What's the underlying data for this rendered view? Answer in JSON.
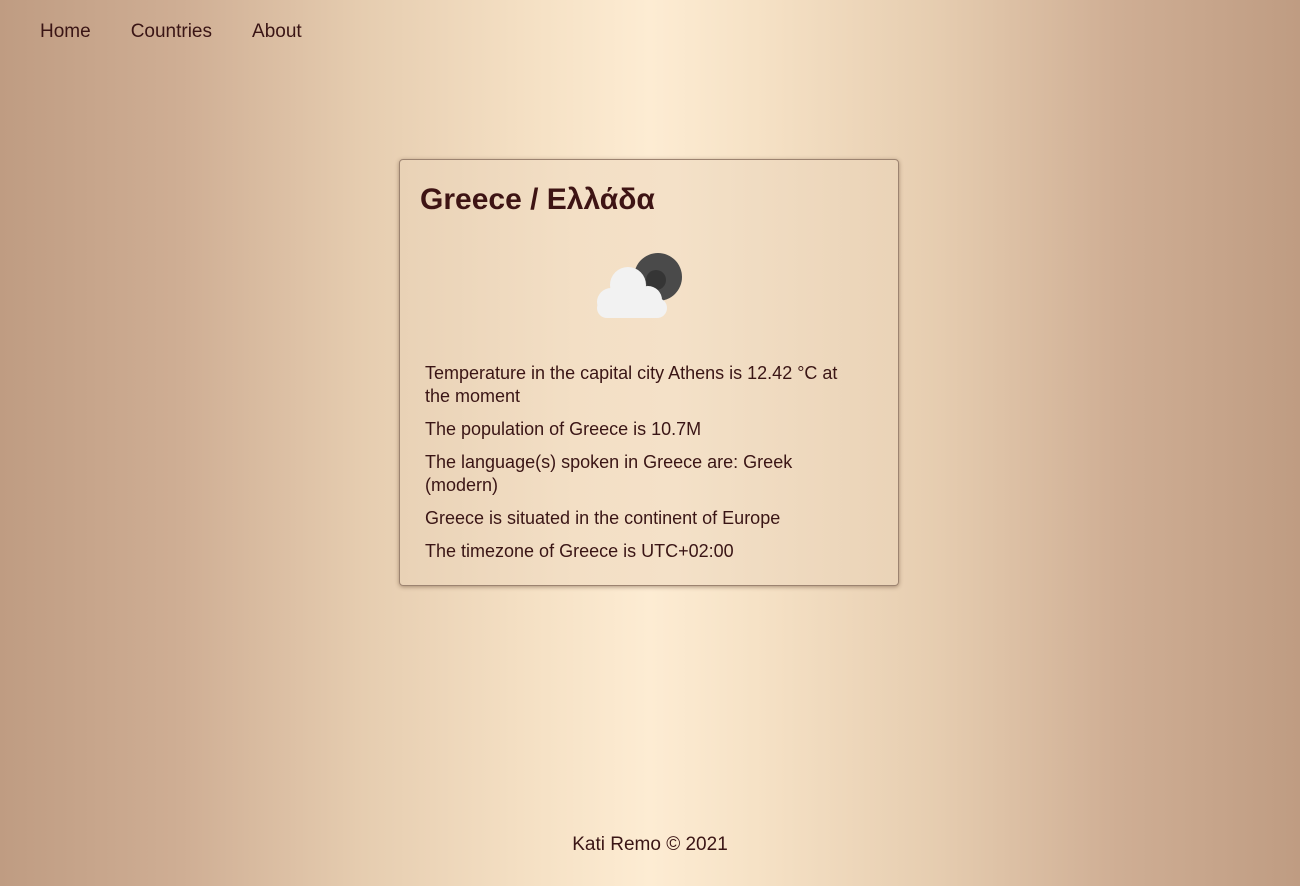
{
  "nav": {
    "items": [
      {
        "label": "Home"
      },
      {
        "label": "Countries"
      },
      {
        "label": "About"
      }
    ]
  },
  "card": {
    "title": "Greece / Ελλάδα",
    "weather_icon": "cloud-moon-icon",
    "facts": [
      "Temperature in the capital city Athens is 12.42 °C at the moment",
      "The population of Greece is 10.7M",
      "The language(s) spoken in Greece are: Greek (modern)",
      "Greece is situated in the continent of Europe",
      "The timezone of Greece is UTC+02:00"
    ]
  },
  "footer": {
    "text": "Kati Remo © 2021"
  },
  "colors": {
    "text": "#3a1515",
    "title": "#3e1414",
    "moon": "#4a4a4a",
    "cloud": "#f2f2f2"
  }
}
